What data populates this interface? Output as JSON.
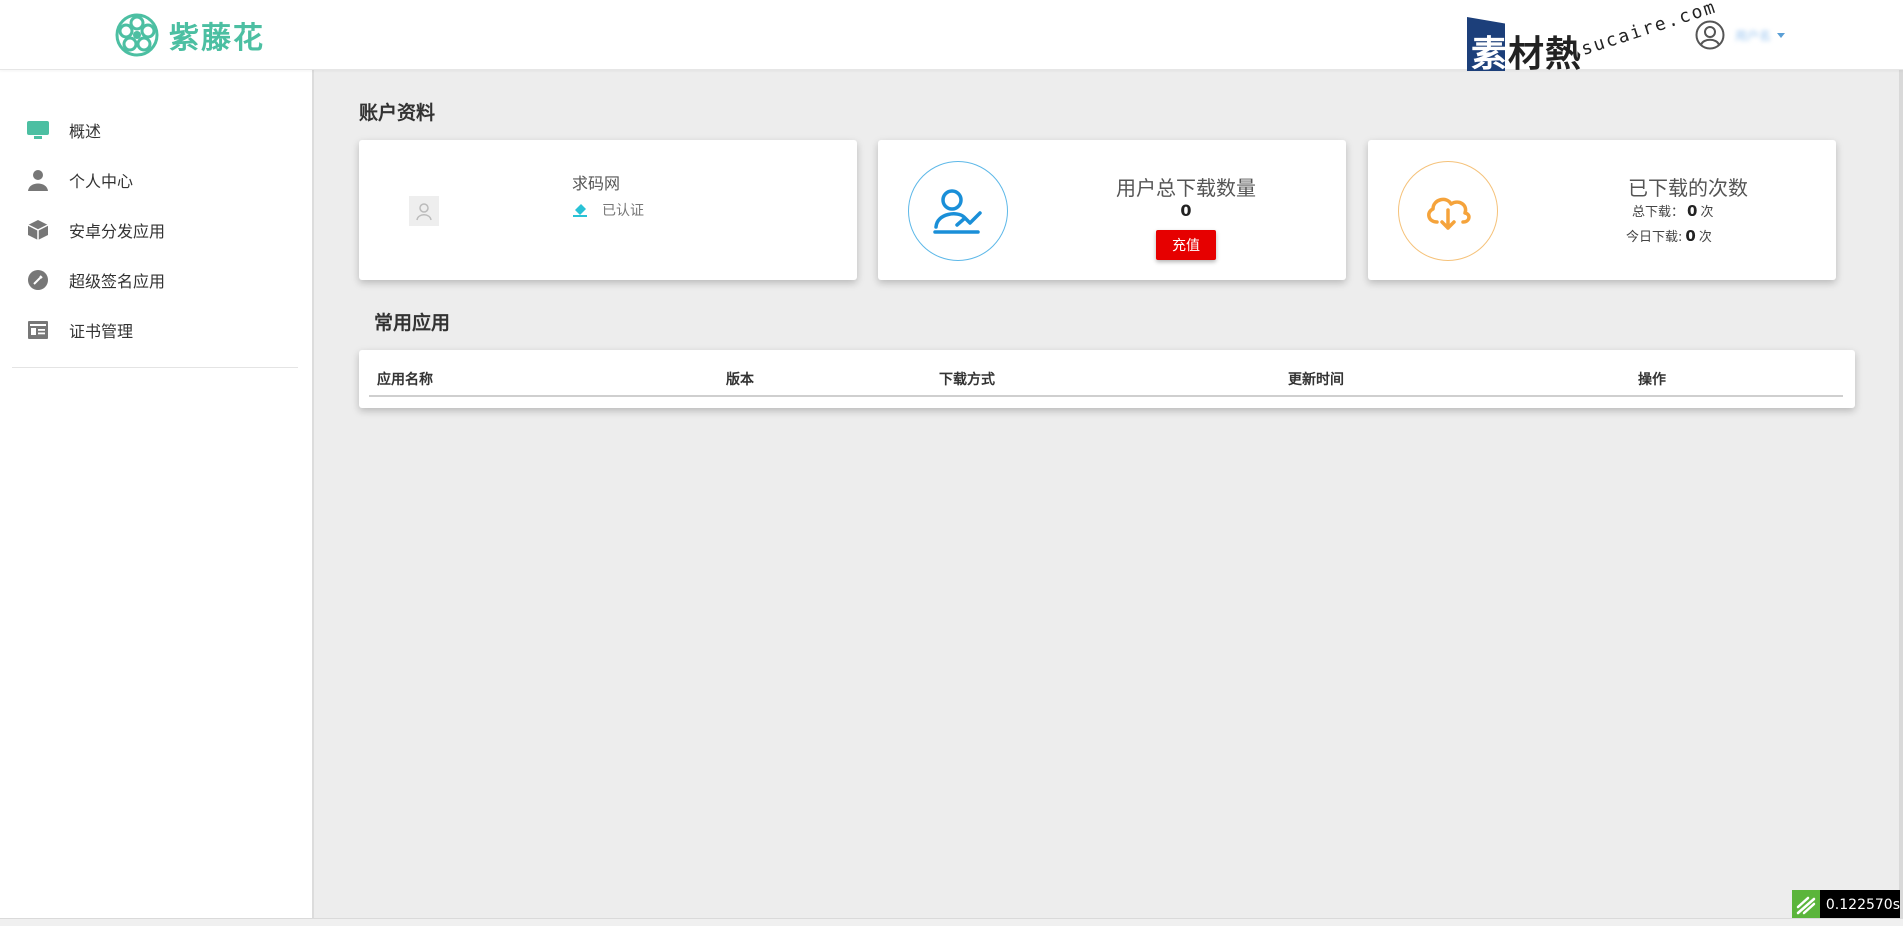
{
  "header": {
    "logo_text": "紫藤花",
    "watermark_text": "素材熱",
    "watermark_first": "素",
    "watermark_rest": "材熱",
    "watermark_url": "sucaire.com",
    "user_name": "用户名"
  },
  "sidebar": {
    "items": [
      {
        "label": "概述",
        "icon": "monitor-icon"
      },
      {
        "label": "个人中心",
        "icon": "person-icon"
      },
      {
        "label": "安卓分发应用",
        "icon": "package-icon"
      },
      {
        "label": "超级签名应用",
        "icon": "pen-icon"
      },
      {
        "label": "证书管理",
        "icon": "certificate-icon"
      }
    ]
  },
  "account": {
    "section_title": "账户资料",
    "name": "求码网",
    "verified_label": "已认证"
  },
  "downloads_card": {
    "title": "用户总下载数量",
    "value": "0",
    "button_label": "充值"
  },
  "count_card": {
    "title": "已下载的次数",
    "total_label": "总下载：",
    "total_value": "0",
    "total_unit": "次",
    "today_label": "今日下载:",
    "today_value": "0",
    "today_unit": "次"
  },
  "apps": {
    "section_title": "常用应用",
    "columns": [
      "应用名称",
      "版本",
      "下载方式",
      "更新时间",
      "操作"
    ]
  },
  "timer": {
    "text": "0.122570s"
  },
  "colors": {
    "brand": "#4cbfa2",
    "accent_blue": "#1a8fd8",
    "accent_orange": "#f5a33b",
    "danger": "#e60000"
  }
}
